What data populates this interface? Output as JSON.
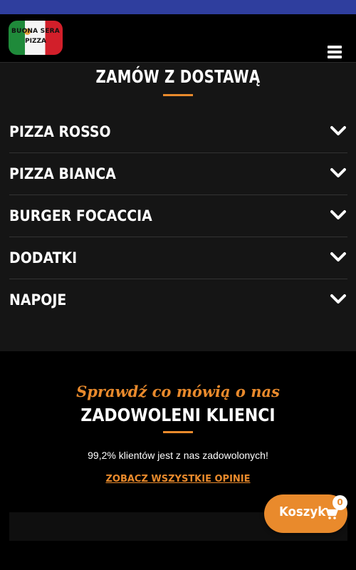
{
  "header": {
    "logo_line1": "BUONA SERA",
    "logo_line2": "PIZZA"
  },
  "order": {
    "title": "ZAMÓW Z DOSTAWĄ",
    "categories": [
      {
        "label": "PIZZA ROSSO"
      },
      {
        "label": "PIZZA BIANCA"
      },
      {
        "label": "BURGER FOCACCIA"
      },
      {
        "label": "DODATKI"
      },
      {
        "label": "NAPOJE"
      }
    ]
  },
  "reviews": {
    "script_title": "Sprawdź co mówią o nas",
    "title": "ZADOWOLENI KLIENCI",
    "stat_text": "99,2% klientów jest z nas zadowolonych!",
    "link_label": "ZOBACZ WSZYSTKIE OPINIE"
  },
  "cart": {
    "label": "Koszyk",
    "count": "0",
    "icon": "cart-icon"
  },
  "colors": {
    "accent": "#e98a2c",
    "status_bar": "#2f3e9e",
    "section_bg": "#151515",
    "page_bg": "#000000"
  }
}
